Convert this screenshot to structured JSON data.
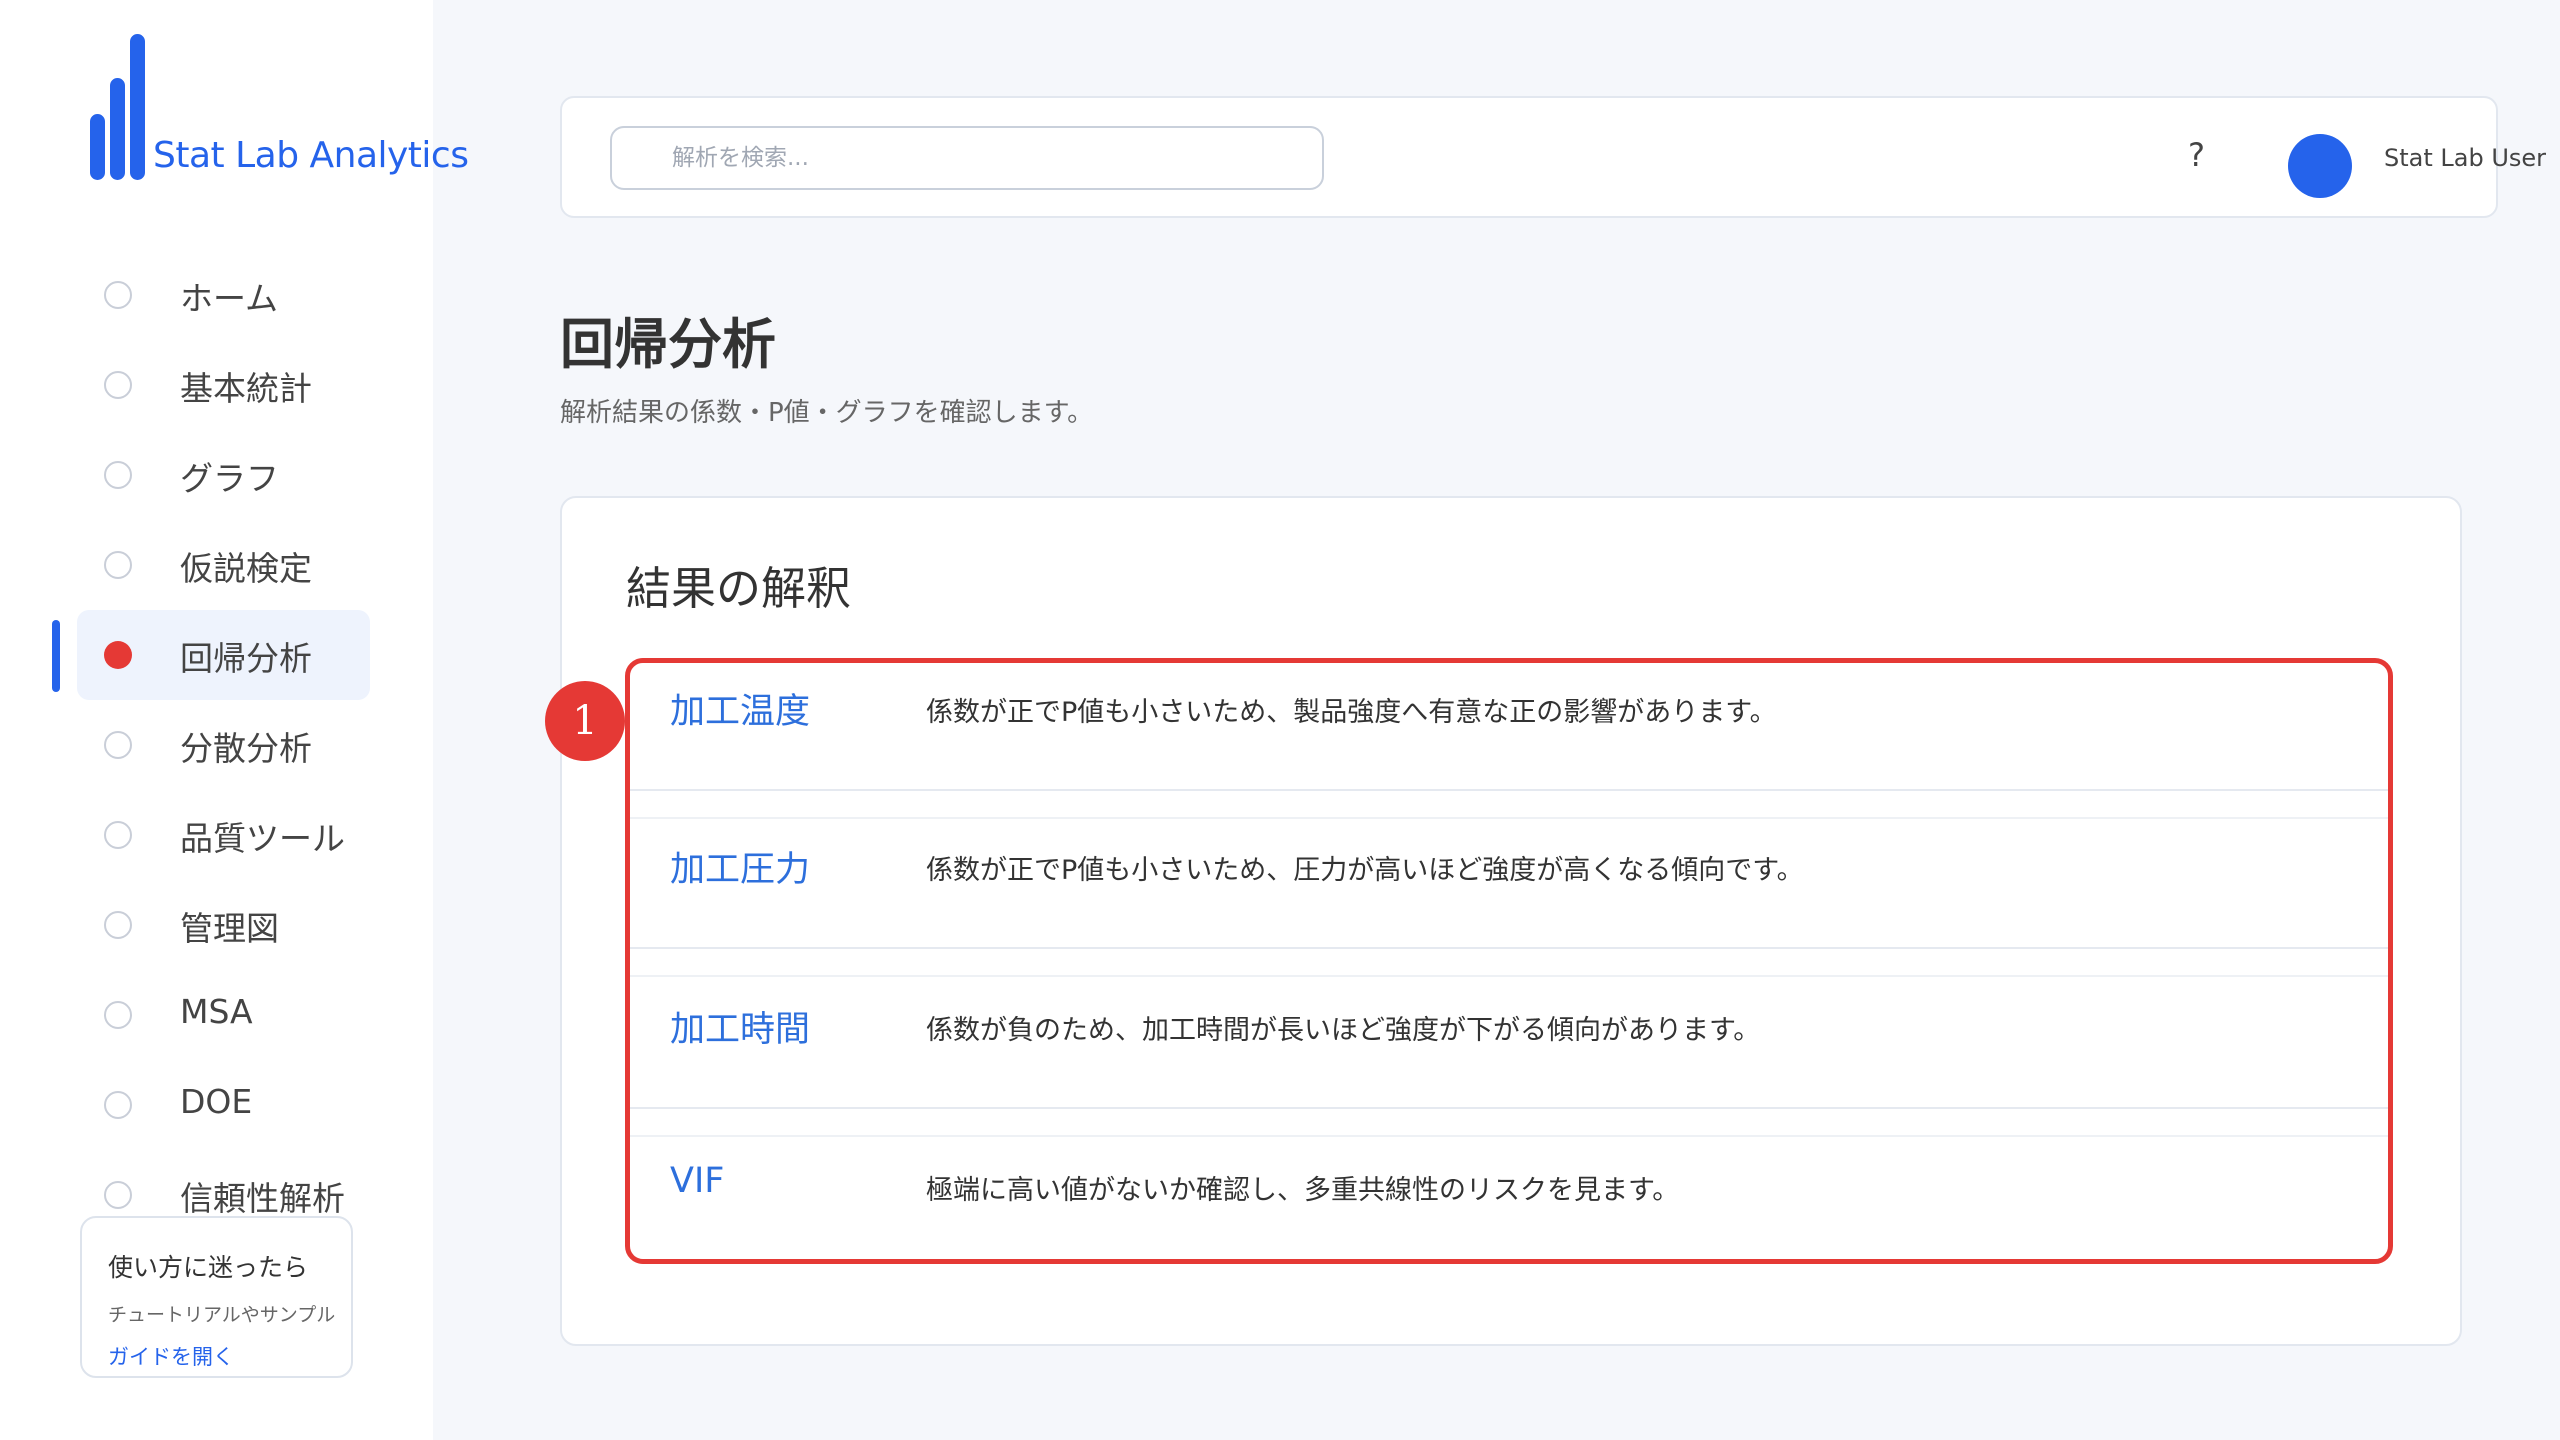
{
  "app": {
    "name": "Stat Lab Analytics"
  },
  "sidebar": {
    "items": [
      {
        "label": "ホーム",
        "active": false
      },
      {
        "label": "基本統計",
        "active": false
      },
      {
        "label": "グラフ",
        "active": false
      },
      {
        "label": "仮説検定",
        "active": false
      },
      {
        "label": "回帰分析",
        "active": true
      },
      {
        "label": "分散分析",
        "active": false
      },
      {
        "label": "品質ツール",
        "active": false
      },
      {
        "label": "管理図",
        "active": false
      },
      {
        "label": "MSA",
        "active": false
      },
      {
        "label": "DOE",
        "active": false
      },
      {
        "label": "信頼性解析",
        "active": false
      }
    ],
    "help": {
      "title": "使い方に迷ったら",
      "subtitle": "チュートリアルやサンプル",
      "link": "ガイドを開く"
    }
  },
  "header": {
    "search_placeholder": "解析を検索...",
    "help_label": "?",
    "user_name": "Stat Lab User"
  },
  "page": {
    "title": "回帰分析",
    "subtitle": "解析結果の係数・P値・グラフを確認します。"
  },
  "card": {
    "title": "結果の解釈",
    "marker": "1",
    "rows": [
      {
        "key": "加工温度",
        "desc": "係数が正でP値も小さいため、製品強度へ有意な正の影響があります。"
      },
      {
        "key": "加工圧力",
        "desc": "係数が正でP値も小さいため、圧力が高いほど強度が高くなる傾向です。"
      },
      {
        "key": "加工時間",
        "desc": "係数が負のため、加工時間が長いほど強度が下がる傾向があります。"
      },
      {
        "key": "VIF",
        "desc": "極端に高い値がないか確認し、多重共線性のリスクを見ます。"
      }
    ]
  },
  "colors": {
    "accent": "#2563eb",
    "highlight": "#e53935",
    "background": "#f5f7fb"
  }
}
